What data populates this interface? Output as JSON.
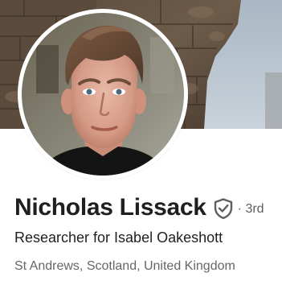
{
  "profile": {
    "name": "Nicholas Lissack",
    "verified_icon": "shield-check-icon",
    "connection_degree": "· 3rd",
    "headline": "Researcher for Isabel Oakeshott",
    "location": "St Andrews, Scotland, United Kingdom"
  },
  "colors": {
    "name_text": "#1f1f1f",
    "secondary_text": "#666666",
    "icon_gray": "#5f5f5f",
    "background": "#ffffff"
  }
}
